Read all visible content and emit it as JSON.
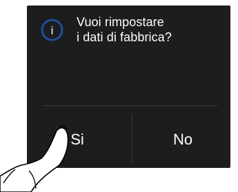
{
  "dialog": {
    "icon": "info-icon",
    "icon_glyph": "i",
    "accent_color": "#1f4ea0",
    "background_color": "#1d1d1d",
    "message_lines": [
      "Vuoi rimpostare",
      "i dati di fabbrica?"
    ],
    "yes_label": "Si",
    "no_label": "No"
  },
  "gesture": {
    "icon": "pointing-hand-icon",
    "target": "yes-button"
  }
}
